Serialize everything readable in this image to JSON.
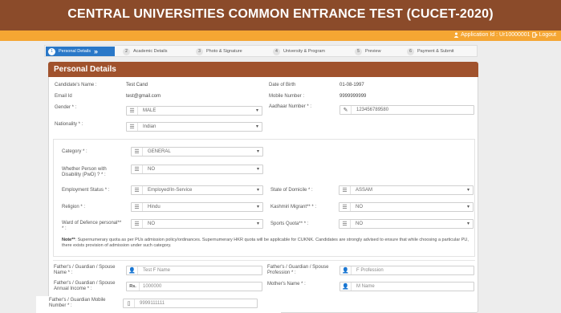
{
  "header": {
    "title": "CENTRAL UNIVERSITIES COMMON ENTRANCE TEST (CUCET-2020)"
  },
  "user_bar": {
    "application_label": "Application Id :",
    "application_id": "Ur10000001",
    "logout_label": "Logout"
  },
  "steps": [
    {
      "num": "1",
      "label": "Personal Details",
      "active": true
    },
    {
      "num": "2",
      "label": "Academic Details"
    },
    {
      "num": "3",
      "label": "Photo & Signature"
    },
    {
      "num": "4",
      "label": "University & Program"
    },
    {
      "num": "5",
      "label": "Preview"
    },
    {
      "num": "6",
      "label": "Payment & Submit"
    }
  ],
  "card": {
    "title": "Personal Details"
  },
  "info": {
    "candidate_name_label": "Candidate's Name :",
    "candidate_name": "Test Cand",
    "dob_label": "Date of Birth",
    "dob": "01-08-1997",
    "email_label": "Email Id",
    "email": "test@gmail.com",
    "mobile_label": "Mobile Number :",
    "mobile": "9999999999"
  },
  "form": {
    "gender_label": "Gender * :",
    "gender": "MALE",
    "aadhaar_label": "Aadhaar Number * :",
    "aadhaar": "123456789580",
    "nationality_label": "Nationality * :",
    "nationality": "Indian",
    "category_label": "Category * :",
    "category": "GENERAL",
    "pwd_label": "Whether Person with Disability (PwD) ? * :",
    "pwd": "NO",
    "employment_label": "Employment Status * :",
    "employment": "Employed/In-Service",
    "domicile_label": "State of Domicile * :",
    "domicile": "ASSAM",
    "religion_label": "Religion * :",
    "religion": "Hindu",
    "kashmiri_label": "Kashmiri Migrant** * :",
    "kashmiri": "NO",
    "ward_label": "Ward of Defence personal** * :",
    "ward": "NO",
    "sports_label": "Sports Quota** * :",
    "sports": "NO",
    "note_bold": "Note**",
    "note_text": ": Supernumerary quota as per PUs admission policy/ordinances. Supernumerary HKR quota will be applicable for CUKNK. Candidates are strongly advised to ensure that while choosing a particular PU, there exists provision of admission under such category.",
    "guardian_name_label": "Father's / Guardian / Spouse Name * :",
    "guardian_name": "Test F Name",
    "guardian_prof_label": "Father's / Guardian / Spouse Profession * :",
    "guardian_prof": "F Profession",
    "guardian_income_label": "Father's / Guardian / Spouse Annual Income * :",
    "income_prefix": "Rs.",
    "guardian_income": "1000000",
    "mother_label": "Mother's Name * :",
    "mother": "M Name",
    "guardian_mobile_label": "Father's / Guardian Mobile Number * :",
    "guardian_mobile": "9999111111"
  }
}
